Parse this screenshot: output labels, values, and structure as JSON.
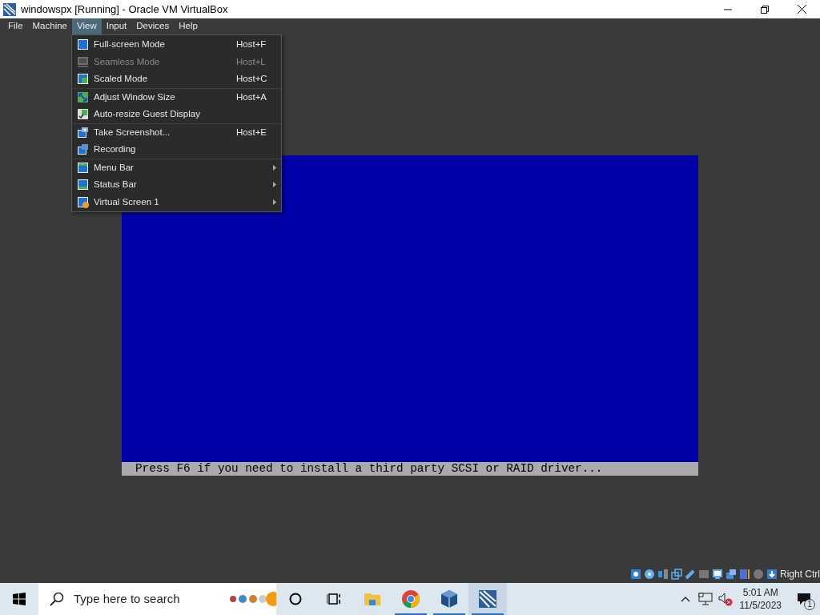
{
  "window": {
    "title": "windowspx [Running] - Oracle VM VirtualBox"
  },
  "menu_bar": [
    {
      "label": "File",
      "selected": false
    },
    {
      "label": "Machine",
      "selected": false
    },
    {
      "label": "View",
      "selected": true
    },
    {
      "label": "Input",
      "selected": false
    },
    {
      "label": "Devices",
      "selected": false
    },
    {
      "label": "Help",
      "selected": false
    }
  ],
  "view_menu": {
    "groups": [
      [
        {
          "label": "Full-screen Mode",
          "shortcut": "Host+F",
          "disabled": false,
          "submenu": false,
          "kind": "fullscreen"
        },
        {
          "label": "Seamless Mode",
          "shortcut": "Host+L",
          "disabled": true,
          "submenu": false,
          "kind": "seamless"
        },
        {
          "label": "Scaled Mode",
          "shortcut": "Host+C",
          "disabled": false,
          "submenu": false,
          "kind": "scaled"
        }
      ],
      [
        {
          "label": "Adjust Window Size",
          "shortcut": "Host+A",
          "disabled": false,
          "submenu": false,
          "kind": "adjust"
        },
        {
          "label": "Auto-resize Guest Display",
          "disabled": false,
          "submenu": false,
          "kind": "autoresize"
        }
      ],
      [
        {
          "label": "Take Screenshot...",
          "shortcut": "Host+E",
          "disabled": false,
          "submenu": false,
          "kind": "screenshot"
        },
        {
          "label": "Recording",
          "disabled": false,
          "submenu": false,
          "kind": "recording"
        }
      ],
      [
        {
          "label": "Menu Bar",
          "disabled": false,
          "submenu": true,
          "kind": "menubar"
        },
        {
          "label": "Status Bar",
          "disabled": false,
          "submenu": true,
          "kind": "statusbar"
        },
        {
          "label": "Virtual Screen 1",
          "disabled": false,
          "submenu": true,
          "kind": "screen"
        }
      ]
    ]
  },
  "guest_screen": {
    "status_line": "Press F6 if you need to install a third party SCSI or RAID driver..."
  },
  "status_bar": {
    "host_key": "Right Ctrl"
  },
  "taskbar": {
    "search": {
      "placeholder": "Type here to search"
    },
    "apps": [
      {
        "kind": "explorer",
        "running": false,
        "selected": false
      },
      {
        "kind": "chrome",
        "running": true,
        "selected": false
      },
      {
        "kind": "virtualbox",
        "running": true,
        "selected": false
      },
      {
        "kind": "vm",
        "running": true,
        "selected": true
      }
    ],
    "clock": {
      "time": "5:01 AM",
      "date": "11/5/2023"
    },
    "notifications": {
      "count": "1"
    }
  }
}
